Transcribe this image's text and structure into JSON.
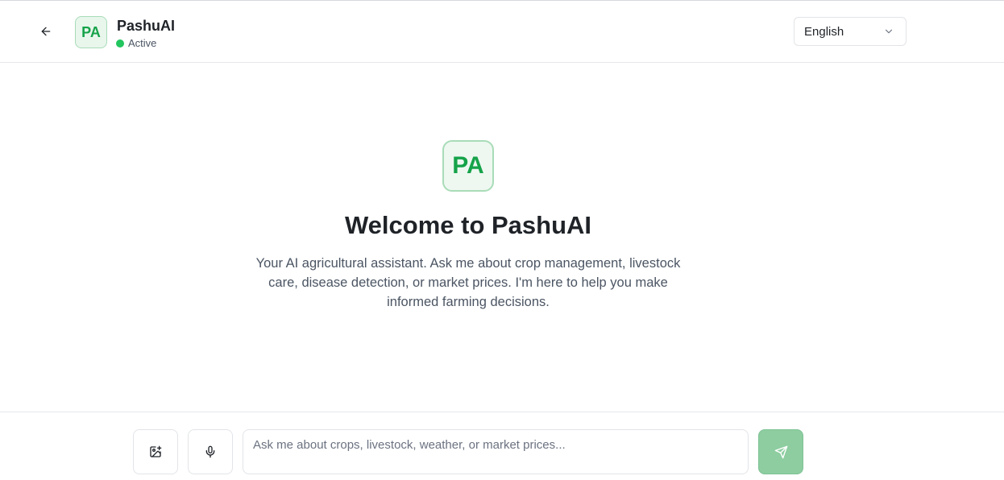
{
  "header": {
    "back_icon": "arrow-left-icon",
    "avatar_initials": "PA",
    "bot_name": "PashuAI",
    "status_text": "Active",
    "status_color": "#22c55e",
    "language": {
      "selected": "English",
      "icon": "chevron-down-icon"
    }
  },
  "welcome": {
    "avatar_initials": "PA",
    "title": "Welcome to PashuAI",
    "description": "Your AI agricultural assistant. Ask me about crop management, livestock care, disease detection, or market prices. I'm here to help you make informed farming decisions."
  },
  "composer": {
    "image_upload_icon": "image-plus-icon",
    "mic_icon": "microphone-icon",
    "placeholder": "Ask me about crops, livestock, weather, or market prices...",
    "value": "",
    "send_icon": "send-icon"
  },
  "colors": {
    "brand_green": "#16a34a",
    "avatar_bg": "#e8f6ec",
    "send_button_bg": "#8dcda0"
  }
}
